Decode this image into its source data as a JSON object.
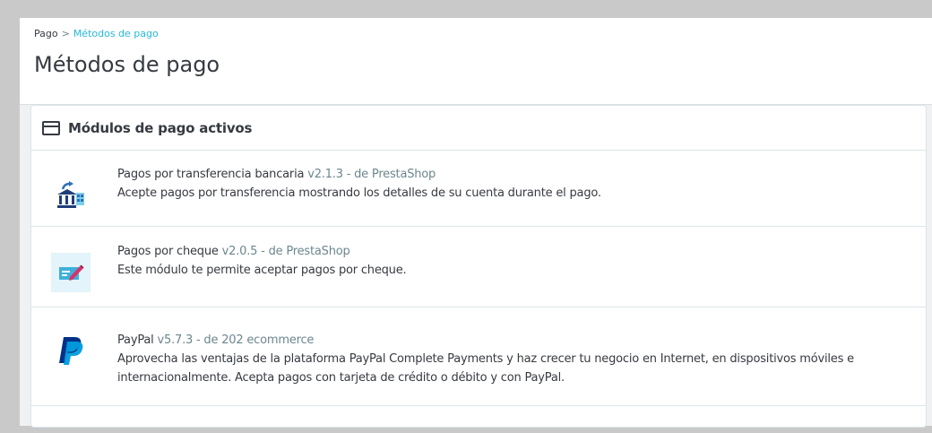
{
  "breadcrumb": {
    "parent": "Pago",
    "separator": ">",
    "current": "Métodos de pago"
  },
  "page": {
    "title": "Métodos de pago"
  },
  "panel": {
    "title": "Módulos de pago activos",
    "icon": "credit-card-icon"
  },
  "modules": [
    {
      "name": "Pagos por transferencia bancaria",
      "meta": "v2.1.3 - de PrestaShop",
      "description": "Acepte pagos por transferencia mostrando los detalles de su cuenta durante el pago.",
      "icon": "bank-transfer-icon"
    },
    {
      "name": "Pagos por cheque",
      "meta": "v2.0.5 - de PrestaShop",
      "description": "Este módulo te permite aceptar pagos por cheque.",
      "icon": "cheque-icon"
    },
    {
      "name": "PayPal",
      "meta": "v5.7.3 - de 202 ecommerce",
      "description": "Aprovecha las ventajas de la plataforma PayPal Complete Payments y haz crecer tu negocio en Internet, en dispositivos móviles e internacionalmente. Acepta pagos con tarjeta de crédito o débito y con PayPal.",
      "icon": "paypal-icon"
    }
  ],
  "colors": {
    "accent": "#25b9d7",
    "text": "#363a41",
    "muted": "#6c868e",
    "paypal_dark": "#003087",
    "paypal_light": "#009cde"
  }
}
